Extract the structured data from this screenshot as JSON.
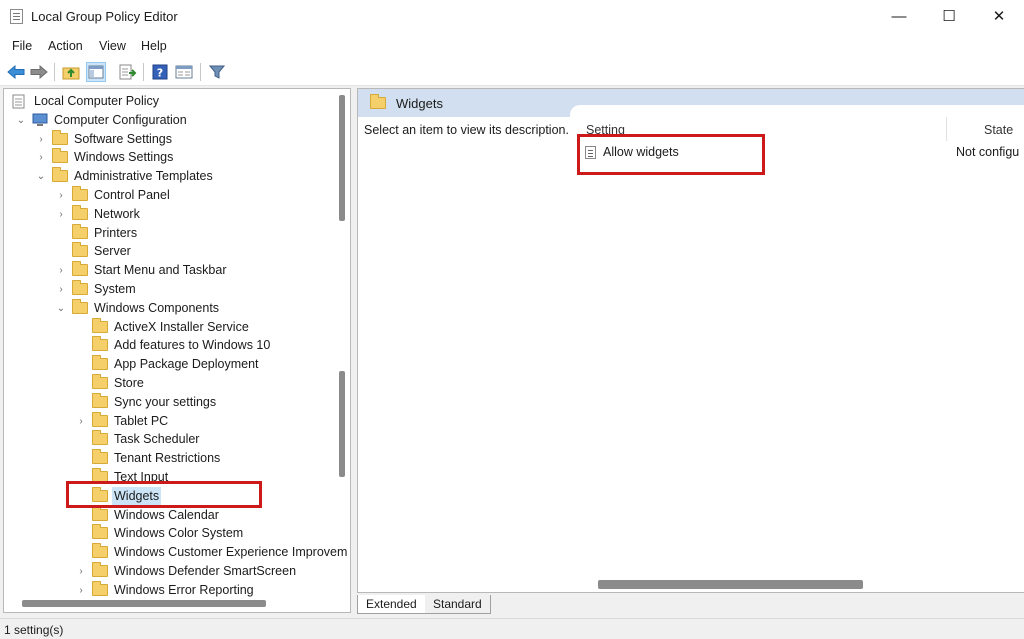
{
  "window": {
    "title": "Local Group Policy Editor",
    "minimize_glyph": "—",
    "maximize_glyph": "☐",
    "close_glyph": "✕"
  },
  "menu": [
    "File",
    "Action",
    "View",
    "Help"
  ],
  "toolbar_icons": [
    "back-arrow-icon",
    "forward-arrow-icon",
    "up-folder-icon",
    "show-hide-tree-icon",
    "export-list-icon",
    "help-icon",
    "properties-icon",
    "filter-icon"
  ],
  "tree": {
    "items": [
      {
        "label": "Local Computer Policy",
        "level": 0,
        "expander": "",
        "icon": "policy-icon"
      },
      {
        "label": "Computer Configuration",
        "level": 1,
        "expander": "expanded",
        "icon": "computer-icon"
      },
      {
        "label": "Software Settings",
        "level": 2,
        "expander": "collapsed",
        "icon": "folder-icon"
      },
      {
        "label": "Windows Settings",
        "level": 2,
        "expander": "collapsed",
        "icon": "folder-icon"
      },
      {
        "label": "Administrative Templates",
        "level": 2,
        "expander": "expanded",
        "icon": "folder-icon"
      },
      {
        "label": "Control Panel",
        "level": 3,
        "expander": "collapsed",
        "icon": "folder-icon"
      },
      {
        "label": "Network",
        "level": 3,
        "expander": "collapsed",
        "icon": "folder-icon"
      },
      {
        "label": "Printers",
        "level": 3,
        "expander": "",
        "icon": "folder-icon"
      },
      {
        "label": "Server",
        "level": 3,
        "expander": "",
        "icon": "folder-icon"
      },
      {
        "label": "Start Menu and Taskbar",
        "level": 3,
        "expander": "collapsed",
        "icon": "folder-icon"
      },
      {
        "label": "System",
        "level": 3,
        "expander": "collapsed",
        "icon": "folder-icon"
      },
      {
        "label": "Windows Components",
        "level": 3,
        "expander": "expanded",
        "icon": "folder-icon"
      },
      {
        "label": "ActiveX Installer Service",
        "level": 4,
        "expander": "",
        "icon": "folder-icon"
      },
      {
        "label": "Add features to Windows 10",
        "level": 4,
        "expander": "",
        "icon": "folder-icon"
      },
      {
        "label": "App Package Deployment",
        "level": 4,
        "expander": "",
        "icon": "folder-icon"
      },
      {
        "label": "Store",
        "level": 4,
        "expander": "",
        "icon": "folder-icon"
      },
      {
        "label": "Sync your settings",
        "level": 4,
        "expander": "",
        "icon": "folder-icon"
      },
      {
        "label": "Tablet PC",
        "level": 4,
        "expander": "collapsed",
        "icon": "folder-icon"
      },
      {
        "label": "Task Scheduler",
        "level": 4,
        "expander": "",
        "icon": "folder-icon"
      },
      {
        "label": "Tenant Restrictions",
        "level": 4,
        "expander": "",
        "icon": "folder-icon"
      },
      {
        "label": "Text Input",
        "level": 4,
        "expander": "",
        "icon": "folder-icon"
      },
      {
        "label": "Widgets",
        "level": 4,
        "expander": "",
        "icon": "folder-icon",
        "selected": true
      },
      {
        "label": "Windows Calendar",
        "level": 4,
        "expander": "",
        "icon": "folder-icon"
      },
      {
        "label": "Windows Color System",
        "level": 4,
        "expander": "",
        "icon": "folder-icon"
      },
      {
        "label": "Windows Customer Experience Improvem",
        "level": 4,
        "expander": "",
        "icon": "folder-icon"
      },
      {
        "label": "Windows Defender SmartScreen",
        "level": 4,
        "expander": "collapsed",
        "icon": "folder-icon"
      },
      {
        "label": "Windows Error Reporting",
        "level": 4,
        "expander": "collapsed",
        "icon": "folder-icon"
      }
    ]
  },
  "details": {
    "folder_title": "Widgets",
    "description": "Select an item to view its description.",
    "columns": {
      "setting": "Setting",
      "state": "State"
    },
    "rows": [
      {
        "setting": "Allow widgets",
        "state": "Not configu"
      }
    ]
  },
  "tabs": {
    "extended": "Extended",
    "standard": "Standard"
  },
  "status": {
    "text": "1 setting(s)"
  },
  "colors": {
    "highlight": "#cc1a1a",
    "selection": "#cce4f7",
    "header_band": "#d2dff0",
    "folder": "#f5cf6a"
  }
}
